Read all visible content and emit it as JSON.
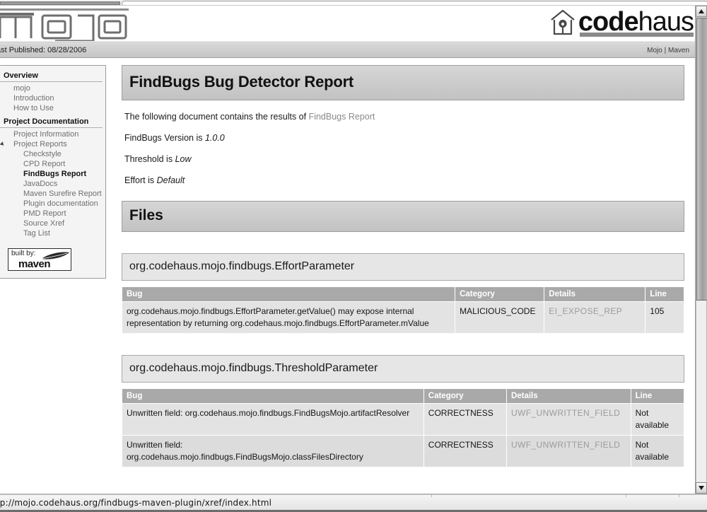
{
  "window": {
    "status_url": "ttp://mojo.codehaus.org/findbugs-maven-plugin/xref/index.html"
  },
  "masthead": {
    "site_logo_text": "mojo",
    "brand_bold": "code",
    "brand_light": "haus",
    "house_icon": "house-icon"
  },
  "pubbar": {
    "published": "ast Published: 08/28/2006",
    "links": "Mojo | Maven"
  },
  "sidebar": {
    "sections": [
      {
        "heading": "Overview",
        "items": [
          {
            "label": "mojo",
            "level": 1,
            "current": false,
            "caret": false
          },
          {
            "label": "Introduction",
            "level": 1,
            "current": false,
            "caret": false
          },
          {
            "label": "How to Use",
            "level": 1,
            "current": false,
            "caret": false
          }
        ]
      },
      {
        "heading": "Project Documentation",
        "items": [
          {
            "label": "Project Information",
            "level": 1,
            "current": false,
            "caret": false
          },
          {
            "label": "Project Reports",
            "level": 1,
            "current": false,
            "caret": true
          },
          {
            "label": "Checkstyle",
            "level": 2,
            "current": false,
            "caret": false
          },
          {
            "label": "CPD Report",
            "level": 2,
            "current": false,
            "caret": false
          },
          {
            "label": "FindBugs Report",
            "level": 2,
            "current": true,
            "caret": false
          },
          {
            "label": "JavaDocs",
            "level": 2,
            "current": false,
            "caret": false
          },
          {
            "label": "Maven Surefire Report",
            "level": 2,
            "current": false,
            "caret": false
          },
          {
            "label": "Plugin documentation",
            "level": 2,
            "current": false,
            "caret": false
          },
          {
            "label": "PMD Report",
            "level": 2,
            "current": false,
            "caret": false
          },
          {
            "label": "Source Xref",
            "level": 2,
            "current": false,
            "caret": false
          },
          {
            "label": "Tag List",
            "level": 2,
            "current": false,
            "caret": false
          }
        ]
      }
    ],
    "badge": {
      "top_text": "built by:",
      "main_text": "maven",
      "icon": "feather-icon"
    }
  },
  "main": {
    "page_title": "FindBugs Bug Detector Report",
    "intro": {
      "prefix": "The following document contains the results of ",
      "link": "FindBugs Report"
    },
    "meta_lines": [
      {
        "label": "FindBugs Version is ",
        "value": "1.0.0"
      },
      {
        "label": "Threshold is ",
        "value": "Low"
      },
      {
        "label": "Effort is ",
        "value": "Default"
      }
    ],
    "files_heading": "Files",
    "columns": [
      "Bug",
      "Category",
      "Details",
      "Line"
    ],
    "files": [
      {
        "name": "org.codehaus.mojo.findbugs.EffortParameter",
        "rows": [
          {
            "bug": "org.codehaus.mojo.findbugs.EffortParameter.getValue() may expose internal representation by returning org.codehaus.mojo.findbugs.EffortParameter.mValue",
            "category": "MALICIOUS_CODE",
            "details": "EI_EXPOSE_REP",
            "line": "105"
          }
        ]
      },
      {
        "name": "org.codehaus.mojo.findbugs.ThresholdParameter",
        "rows": [
          {
            "bug": "Unwritten field: org.codehaus.mojo.findbugs.FindBugsMojo.artifactResolver",
            "category": "CORRECTNESS",
            "details": "UWF_UNWRITTEN_FIELD",
            "line": "Not available"
          },
          {
            "bug": "Unwritten field: org.codehaus.mojo.findbugs.FindBugsMojo.classFilesDirectory",
            "category": "CORRECTNESS",
            "details": "UWF_UNWRITTEN_FIELD",
            "line": "Not available"
          }
        ]
      }
    ]
  },
  "scrollbar": {
    "up_icon": "scroll-up-arrow-icon",
    "down_icon": "scroll-down-arrow-icon"
  },
  "colors": {
    "band": "#c8c8c8",
    "header_row": "#a9a9a9",
    "row": "#e3e3e3",
    "link": "#8a8a8a"
  }
}
